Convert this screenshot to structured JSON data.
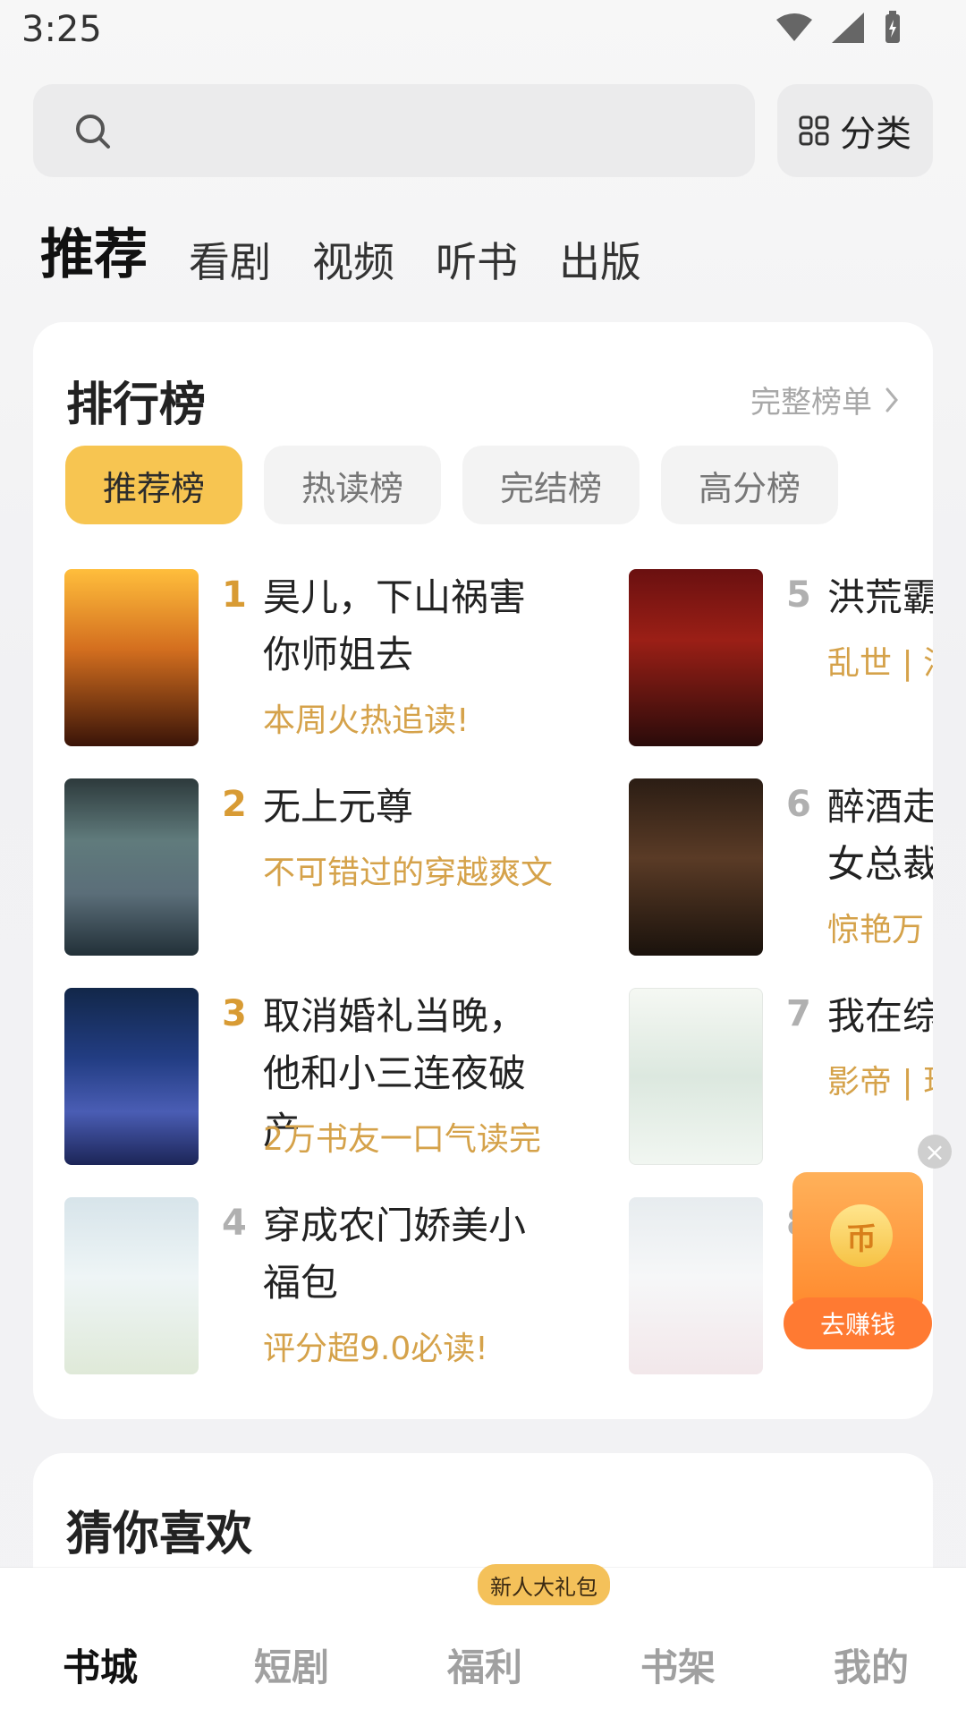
{
  "status": {
    "time": "3:25"
  },
  "search": {
    "category_label": "分类"
  },
  "tabs": [
    "推荐",
    "看剧",
    "视频",
    "听书",
    "出版"
  ],
  "ranking": {
    "title": "排行榜",
    "more": "完整榜单",
    "chips": [
      "推荐榜",
      "热读榜",
      "完结榜",
      "高分榜"
    ],
    "books": [
      {
        "rank": "1",
        "title": "昊儿，下山祸害你师姐去",
        "tag": "本周火热追读!"
      },
      {
        "rank": "2",
        "title": "无上元尊",
        "tag": "不可错过的穿越爽文"
      },
      {
        "rank": "3",
        "title": "取消婚礼当晚，他和小三连夜破产",
        "tag": "2万书友一口气读完"
      },
      {
        "rank": "4",
        "title": "穿成农门娇美小福包",
        "tag": "评分超9.0必读!"
      },
      {
        "rank": "5",
        "title": "洪荒霸",
        "tag": "乱世 | 洪"
      },
      {
        "rank": "6",
        "title": "醉酒走",
        "title2": "女总裁",
        "tag": "惊艳万"
      },
      {
        "rank": "7",
        "title": "我在综",
        "tag": "影帝 | 现"
      },
      {
        "rank": "8",
        "title": "",
        "tag": ""
      }
    ]
  },
  "promo": {
    "earn_label": "去赚钱",
    "close": "×"
  },
  "guess": {
    "title": "猜你喜欢"
  },
  "nav": {
    "items": [
      "书城",
      "短剧",
      "福利",
      "书架",
      "我的"
    ],
    "badge": "新人大礼包"
  },
  "colors": {
    "accent": "#f7c551",
    "rank_orange": "#d89b34",
    "tag_orange": "#d5a24a"
  }
}
